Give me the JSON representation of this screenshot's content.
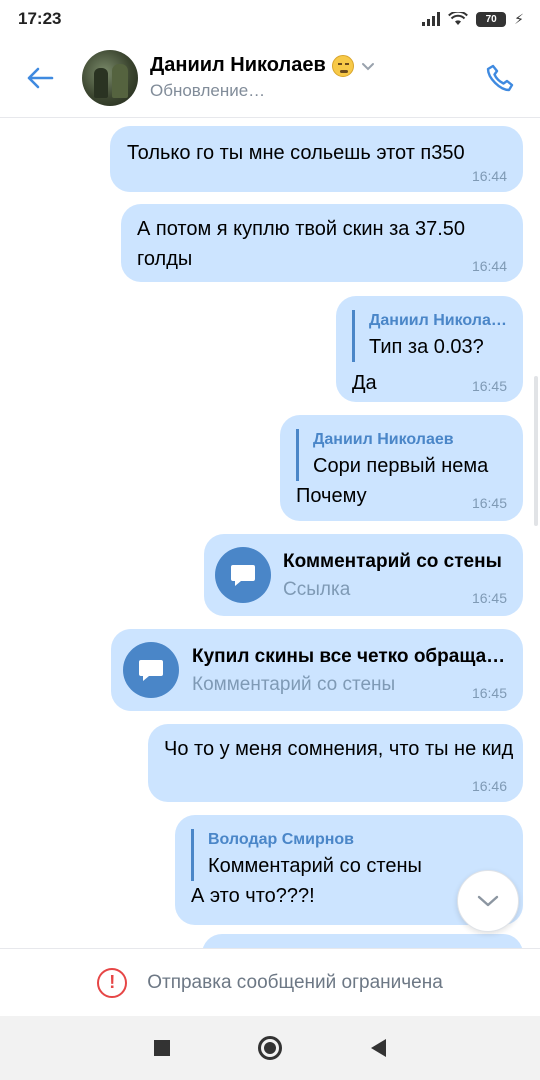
{
  "status_bar": {
    "time": "17:23",
    "battery": "70"
  },
  "header": {
    "contact_name": "Даниил Николаев",
    "status": "Обновление…"
  },
  "messages": [
    {
      "text": "Только го ты мне сольешь этот п350",
      "time": "16:44"
    },
    {
      "text": "А потом я куплю твой скин за 37.50 голды",
      "time": "16:44"
    },
    {
      "reply_author": "Даниил Никола…",
      "reply_text": "Тип за 0.03?",
      "text": "Да",
      "time": "16:45"
    },
    {
      "reply_author": "Даниил Николаев",
      "reply_text": "Сори первый нема",
      "text": "Почему",
      "time": "16:45"
    },
    {
      "attachment_title": "Комментарий со стены",
      "attachment_subtitle": "Ссылка",
      "time": "16:45"
    },
    {
      "attachment_title": "Купил скины все четко обраща…",
      "attachment_subtitle": "Комментарий со стены",
      "time": "16:45"
    },
    {
      "text": "Чо то у меня сомнения, что ты не кид",
      "time": "16:46"
    },
    {
      "reply_author": "Володар Смирнов",
      "reply_text": "Комментарий со стены",
      "text": "А это что???!"
    }
  ],
  "restricted_notice": "Отправка сообщений ограничена",
  "colors": {
    "bubble": "#cce4ff",
    "accent": "#4a86c8",
    "error": "#e64646"
  }
}
